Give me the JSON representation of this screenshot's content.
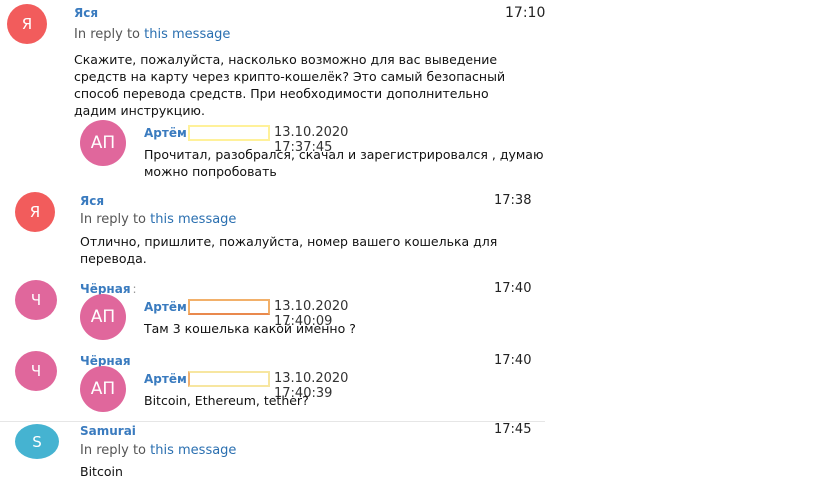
{
  "reply_prefix": "In reply to",
  "reply_link": "this message",
  "messages": [
    {
      "avatar_letter": "Я",
      "sender": "Яся",
      "time": "17:10",
      "reply": true,
      "text": "Скажите, пожалуйста, насколько возможно для вас выведение средств на карту через крипто-кошелёк? Это самый безопасный способ перевода средств. При необходимости дополнительно дадим инструкцию.",
      "quote": {
        "avatar": "АП",
        "name": "Артём",
        "date": "13.10.2020 17:37:45",
        "text": "Прочитал, разобрался, скачал и зарегистрировался , думаю можно попробовать"
      }
    },
    {
      "avatar_letter": "Я",
      "sender": "Яся",
      "time": "17:38",
      "reply": true,
      "text": "Отлично, пришлите, пожалуйста, номер вашего кошелька для перевода."
    },
    {
      "avatar_letter": "Ч",
      "sender": "Чёрная",
      "time": "17:40",
      "reply": false,
      "quote": {
        "avatar": "АП",
        "name": "Артём",
        "date": "13.10.2020 17:40:09",
        "text": "Там 3 кошелька какой именно ?"
      }
    },
    {
      "avatar_letter": "Ч",
      "sender": "Чёрная",
      "time": "17:40",
      "reply": false,
      "quote": {
        "avatar": "АП",
        "name": "Артём",
        "date": "13.10.2020 17:40:39",
        "text": "Bitcoin, Ethereum, tether?"
      }
    },
    {
      "avatar_letter": "S",
      "sender": "Samurai",
      "time": "17:45",
      "reply": true,
      "text": "Bitcoin"
    }
  ],
  "colors": {
    "ya_avatar": "#f25c5c",
    "ch_avatar": "#e0679c",
    "s_avatar": "#45b3d1",
    "sender_name": "#3a7bbf",
    "link": "#2a6fb0"
  }
}
